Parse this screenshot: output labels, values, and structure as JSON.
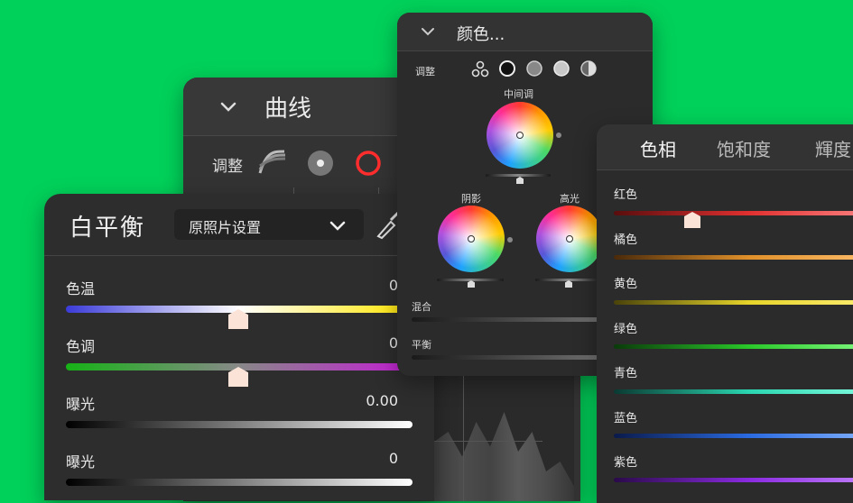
{
  "curves": {
    "title": "曲线",
    "adjust_label": "调整"
  },
  "white_balance": {
    "title": "白平衡",
    "preset_select": "原照片设置",
    "rows": [
      {
        "label": "色温",
        "value": "0"
      },
      {
        "label": "色调",
        "value": "0"
      },
      {
        "label": "曝光",
        "value": "0.00"
      },
      {
        "label": "曝光",
        "value": "0"
      }
    ]
  },
  "color_grading": {
    "title": "颜色...",
    "adjust_label": "调整",
    "midtones_label": "中间调",
    "shadows_label": "阴影",
    "highlights_label": "高光",
    "blend_label": "混合",
    "balance_label": "平衡"
  },
  "hsl": {
    "tabs": [
      "色相",
      "饱和度",
      "輝度"
    ],
    "active_tab": 0,
    "colors": [
      {
        "label": "红色",
        "gradient": [
          "#5a0d0d",
          "#e03030",
          "#ff8a8a"
        ]
      },
      {
        "label": "橘色",
        "gradient": [
          "#4a2a0a",
          "#e0902a",
          "#ffc070"
        ]
      },
      {
        "label": "黄色",
        "gradient": [
          "#4a430a",
          "#e6d42a",
          "#fff07a"
        ]
      },
      {
        "label": "绿色",
        "gradient": [
          "#0a3a0a",
          "#2ac82a",
          "#8aff8a"
        ]
      },
      {
        "label": "青色",
        "gradient": [
          "#0a3a32",
          "#2ad6b0",
          "#8affe4"
        ]
      },
      {
        "label": "蓝色",
        "gradient": [
          "#0a1a4a",
          "#2a6ae0",
          "#8ab8ff"
        ]
      },
      {
        "label": "紫色",
        "gradient": [
          "#2a0a4a",
          "#8a2ae0",
          "#c88aff"
        ]
      }
    ]
  },
  "colors": {
    "background": "#00d15a",
    "thumb": "#fbe3d8"
  }
}
